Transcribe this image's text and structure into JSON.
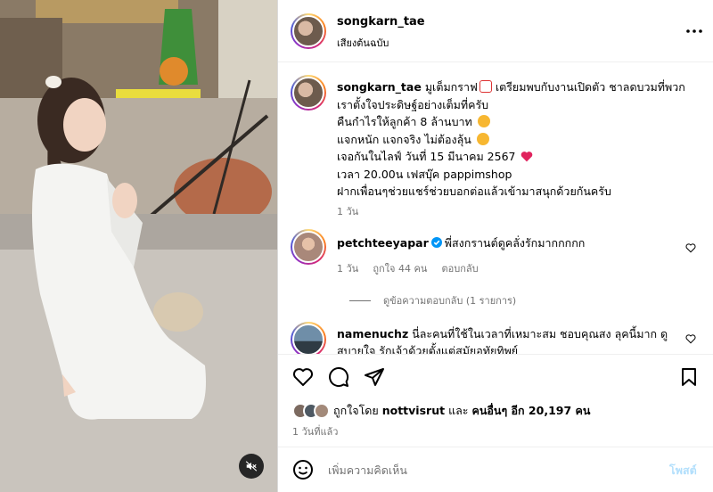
{
  "post": {
    "author": {
      "username": "songkarn_tae",
      "audio_label": "เสียงต้นฉบับ"
    },
    "caption": {
      "username": "songkarn_tae",
      "lines": [
        "มูเต็มกราฟ",
        "เตรียมพบกับงานเปิดตัว ชาลดบวมที่พวก",
        "เราตั้งใจประดิษฐ์อย่างเต็มที่ครับ",
        "คืนกำไรให้ลูกค้า 8 ล้านบาท",
        "แจกหนัก แจกจริง ไม่ต้องลุ้น",
        "เจอกันในไลฟ์ วันที่ 15 มีนาคม 2567",
        "เวลา 20.00น เฟสบุ๊ค pappimshop",
        "ฝากเพื่อนๆช่วยแชร์ช่วยบอกต่อแล้วเข้ามาสนุกด้วยกันครับ"
      ],
      "time": "1 วัน"
    },
    "comments": [
      {
        "username": "petchteeyapar",
        "verified": true,
        "text": "พี่สงกรานต์ดูคลั่งรักมากกกกก",
        "time": "1 วัน",
        "likes": "ถูกใจ 44 คน",
        "reply_label": "ตอบกลับ",
        "view_replies": "ดูข้อความตอบกลับ (1 รายการ)"
      },
      {
        "username": "namenuchz",
        "text_line1": "นี่ละคนที่ใช้ในเวลาที่เหมาะสม ชอบคุณสง ลุคนี้มาก ดู",
        "text_line2": "สบายใจ รักเจ้าด้วยตั้งแต่สมัยอุทัยทิพย์"
      }
    ],
    "likes": {
      "prefix": "ถูกใจโดย",
      "first_liker": "nottvisrut",
      "connector": "และ",
      "others": "คนอื่นๆ อีก 20,197 คน"
    },
    "date": "1 วันที่แล้ว",
    "composer": {
      "placeholder": "เพิ่มความคิดเห็น",
      "post_label": "โพสต์"
    }
  },
  "colors": {
    "link_blue": "#0095f6",
    "like_red": "#ed4956",
    "muted_text": "#737373",
    "post_button_disabled": "#b2dffc"
  },
  "icons": [
    "more-horizontal-icon",
    "heart-icon",
    "comment-icon",
    "share-icon",
    "bookmark-icon",
    "emoji-icon",
    "mute-icon",
    "verified-badge-icon"
  ]
}
